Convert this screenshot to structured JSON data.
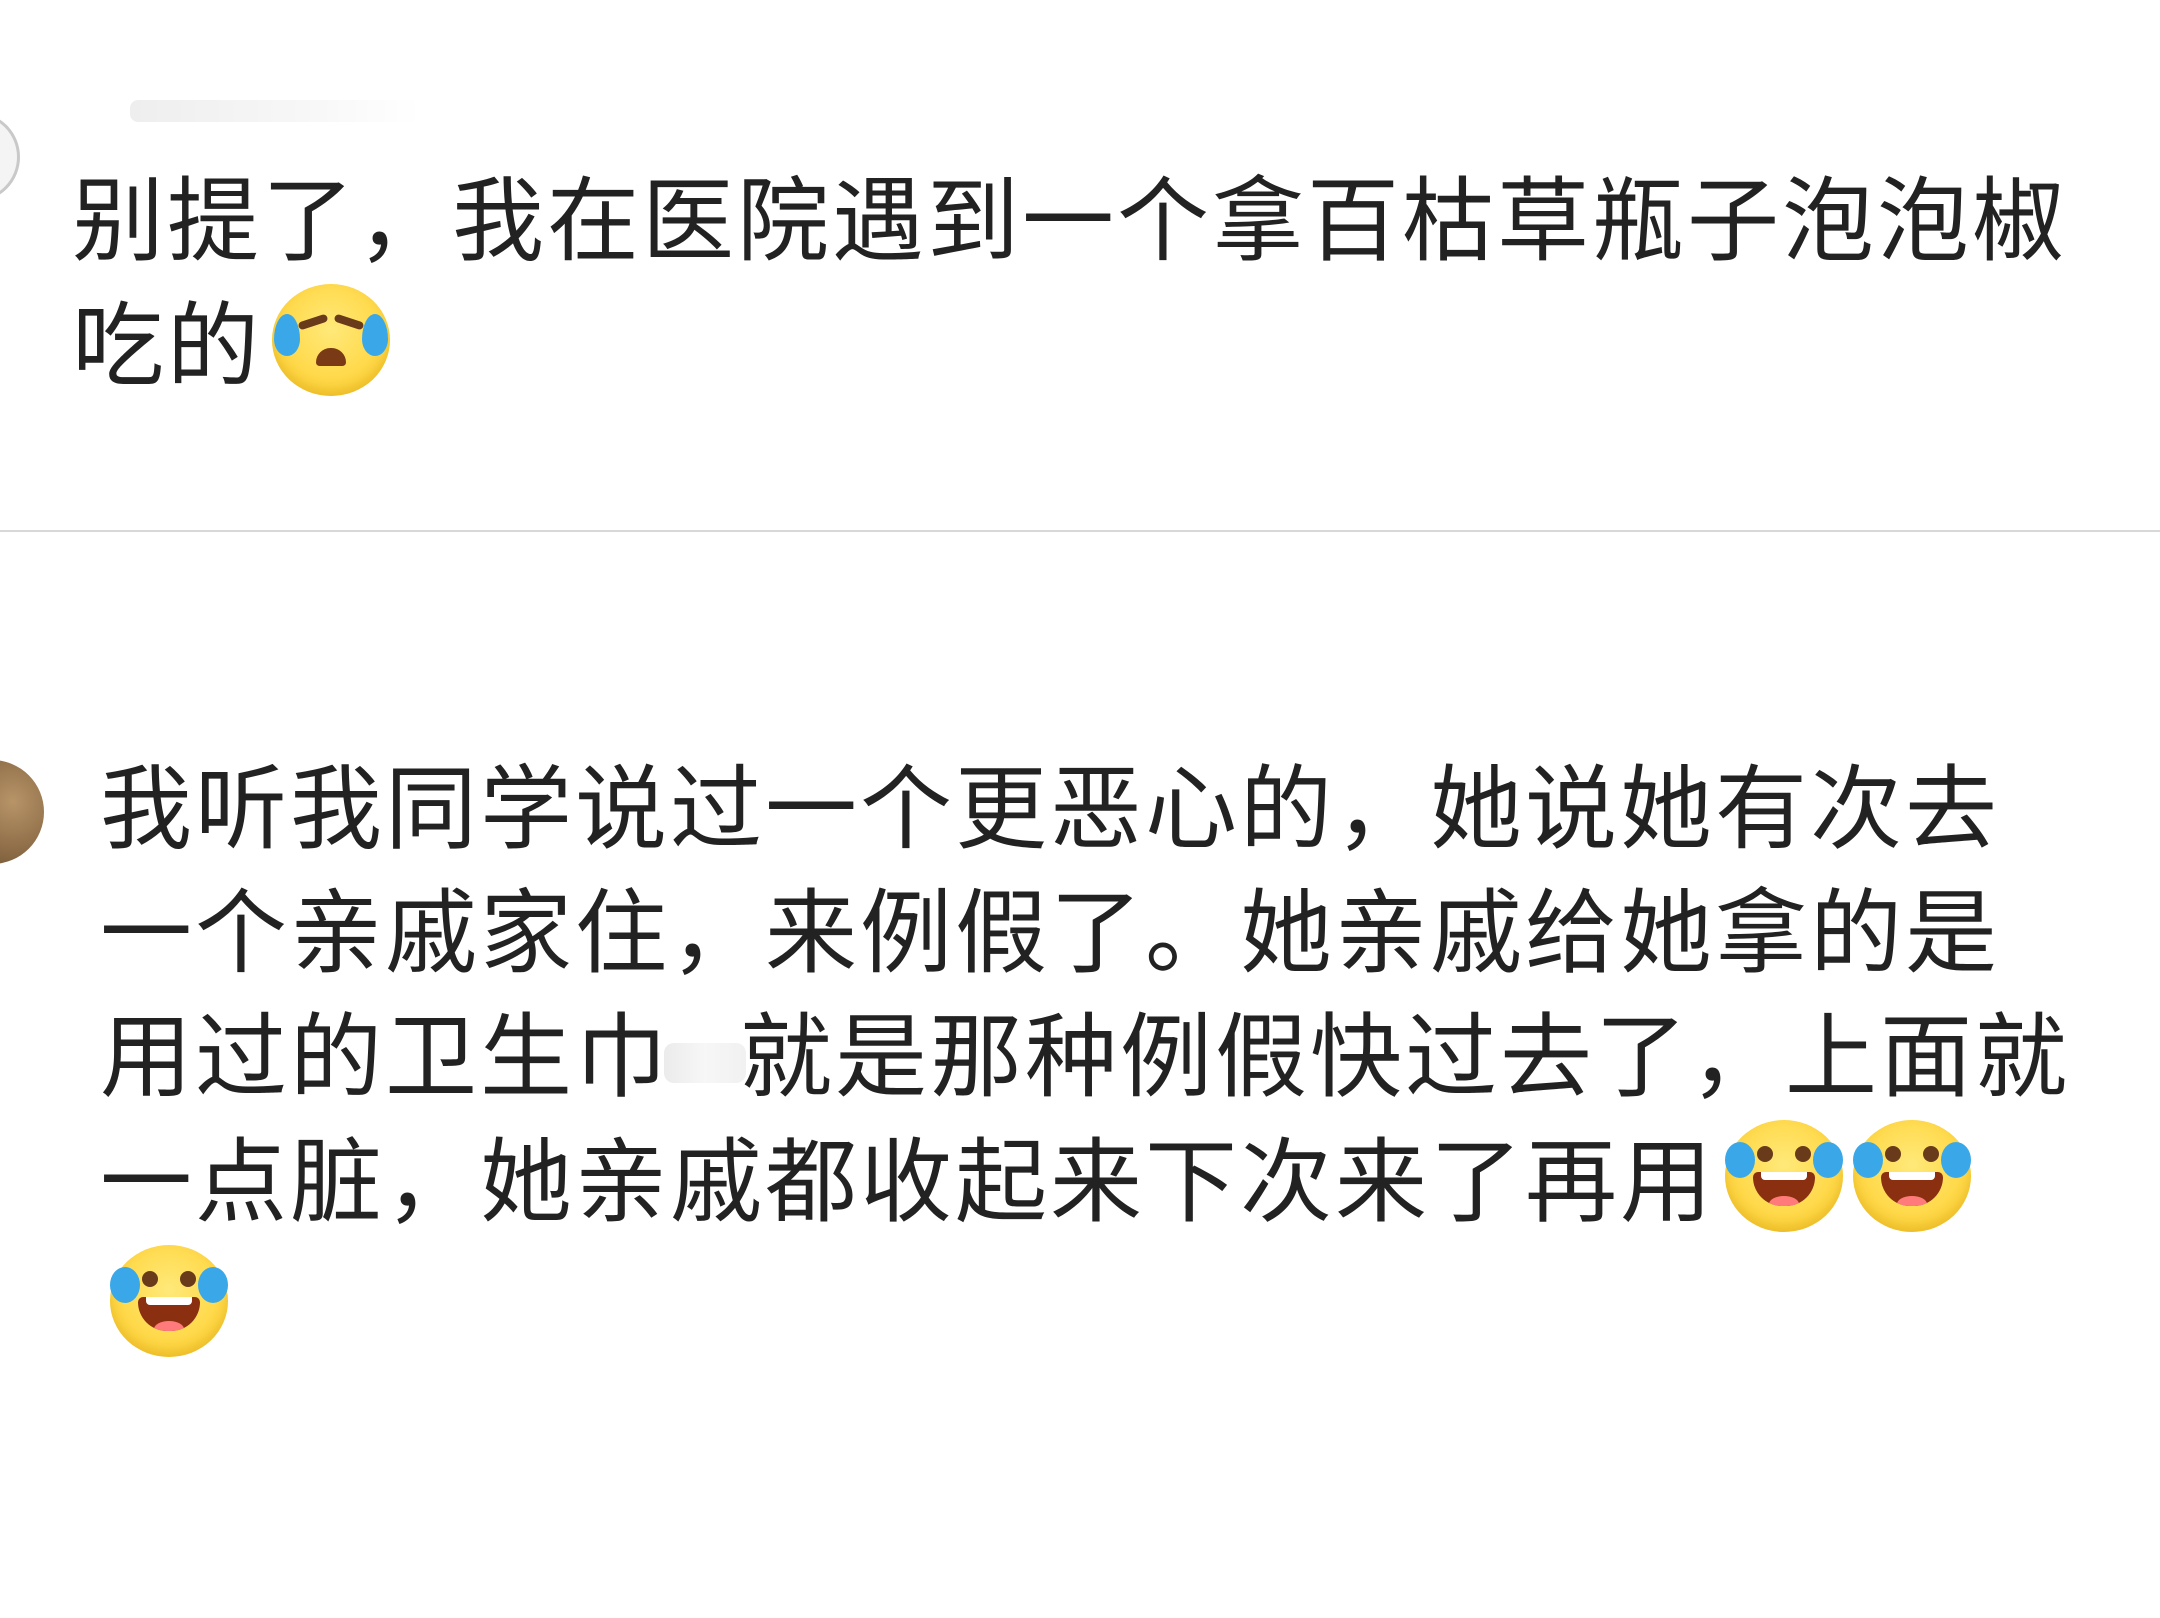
{
  "comments": [
    {
      "id": "comment-1",
      "text_lead": "别提了，我在医院遇到一个拿百枯草瓶子泡泡椒吃的",
      "trailing_emojis": [
        "crying-face-icon"
      ]
    },
    {
      "id": "comment-2",
      "text_part1": "我听我同学说过一个更恶心的，她说她有次去一个亲戚家住，来例假了。她亲戚给她拿的是用过的卫生巾",
      "text_part2": "就是那种例假快过去了，上面就一点脏，她亲戚都收起来下次来了再用",
      "trailing_emojis": [
        "laughing-crying-face-icon",
        "laughing-crying-face-icon",
        "laughing-crying-face-icon"
      ]
    }
  ],
  "colors": {
    "text": "#222222",
    "divider": "#d8d8d8",
    "background": "#ffffff",
    "emoji_yellow": "#ffd94a",
    "tear_blue": "#3aa8e8"
  }
}
